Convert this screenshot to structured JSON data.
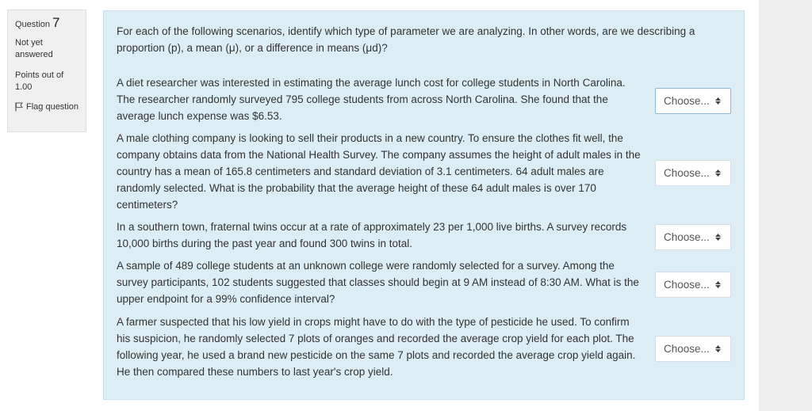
{
  "info": {
    "question_word": "Question",
    "question_number": "7",
    "state": "Not yet answered",
    "grade": "Points out of 1.00",
    "flag_label": "Flag question"
  },
  "question_text": "For each of the following scenarios, identify which type of parameter we are analyzing. In other words, are we describing a proportion (p), a mean (μ), or a difference in means (μd)?",
  "subquestions": [
    {
      "text": "A diet researcher was interested in estimating the average lunch cost for college students in North Carolina. The researcher randomly surveyed 795 college students from across North Carolina. She found that the average lunch expense was $6.53.",
      "select_value": "Choose..."
    },
    {
      "text": "A male clothing company is looking to sell their products in a new country. To ensure the clothes fit well, the company obtains data from the National Health Survey. The company assumes the height of adult males in the country has a mean of 165.8 centimeters and standard deviation of 3.1 centimeters. 64 adult males are randomly selected. What is the probability that the average height of these 64 adult males is over 170 centimeters?",
      "select_value": "Choose..."
    },
    {
      "text": "In a southern town, fraternal twins occur at a rate of approximately 23 per 1,000 live births. A survey records 10,000 births during the past year and found 300 twins in total.",
      "select_value": "Choose..."
    },
    {
      "text": "A sample of 489 college students at an unknown college were randomly selected for a survey. Among the survey participants, 102 students suggested that classes should begin at 9 AM instead of 8:30 AM. What is the upper endpoint for a 99% confidence interval?",
      "select_value": "Choose..."
    },
    {
      "text": "A farmer suspected that his low yield in crops might have to do with the type of pesticide he used. To confirm his suspicion, he randomly selected 7 plots of oranges and recorded the average crop yield for each plot. The following year, he used a brand new pesticide on the same 7 plots and recorded the average crop yield again. He then compared these numbers to last year's crop yield.",
      "select_value": "Choose..."
    }
  ],
  "colors": {
    "panel_background": "#dcedf6",
    "info_background": "#f0f0f0",
    "gutter_background": "#eeeeee"
  }
}
